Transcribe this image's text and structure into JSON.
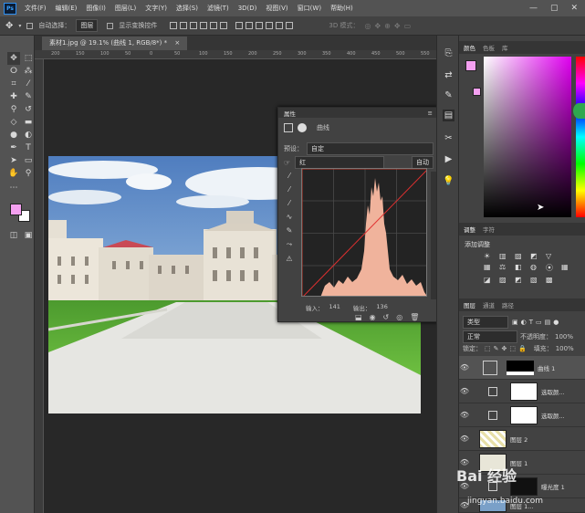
{
  "menubar": {
    "logo": "Ps",
    "items": [
      "文件(F)",
      "编辑(E)",
      "图像(I)",
      "图层(L)",
      "文字(Y)",
      "选择(S)",
      "滤镜(T)",
      "3D(D)",
      "视图(V)",
      "窗口(W)",
      "帮助(H)"
    ],
    "window_controls": [
      "—",
      "▢",
      "✕"
    ]
  },
  "options_bar": {
    "auto_select_label": "自动选择：",
    "auto_select_value": "图层",
    "show_transform_label": "显示变换控件",
    "mode_3d_label": "3D 模式："
  },
  "document_tab": {
    "title": "素材1.jpg @ 19.1% (曲线 1, RGB/8*) *",
    "close": "×"
  },
  "ruler_ticks": [
    "200",
    "150",
    "100",
    "50",
    "0",
    "50",
    "100",
    "150",
    "200",
    "250",
    "300",
    "350",
    "400",
    "450",
    "500",
    "550"
  ],
  "properties_panel": {
    "title": "属性",
    "subtitle": "曲线",
    "preset_label": "预设：",
    "preset_value": "自定",
    "channel_value": "红",
    "auto_button": "自动",
    "input_label": "输入：",
    "input_value": "141",
    "output_label": "输出：",
    "output_value": "136"
  },
  "color_panel": {
    "tabs": [
      "颜色",
      "色板",
      "库"
    ]
  },
  "adjustments_panel": {
    "tabs": [
      "调整",
      "字符"
    ],
    "add_label": "添加调整"
  },
  "layers_panel": {
    "tabs": [
      "图层",
      "通道",
      "路径"
    ],
    "filter_value": "类型",
    "blend_mode": "正常",
    "opacity_label": "不透明度：",
    "opacity_value": "100%",
    "lock_label": "锁定：",
    "fill_label": "填充：",
    "fill_value": "100%",
    "layers": [
      {
        "name": "曲线 1",
        "type": "adjustment"
      },
      {
        "name": "选取颜...",
        "type": "adjustment"
      },
      {
        "name": "选取颜...",
        "type": "adjustment"
      },
      {
        "name": "图层 2",
        "type": "pixel"
      },
      {
        "name": "图层 1",
        "type": "pixel"
      },
      {
        "name": "曝光度 1",
        "type": "adjustment"
      },
      {
        "name": "图层 1...",
        "type": "pixel"
      }
    ]
  },
  "watermark": {
    "text": "Bai 经验",
    "url": "jingyan.baidu.com"
  },
  "colors": {
    "foreground": "#f4a0f0",
    "background": "#ffffff",
    "accent": "#31a8ff"
  }
}
